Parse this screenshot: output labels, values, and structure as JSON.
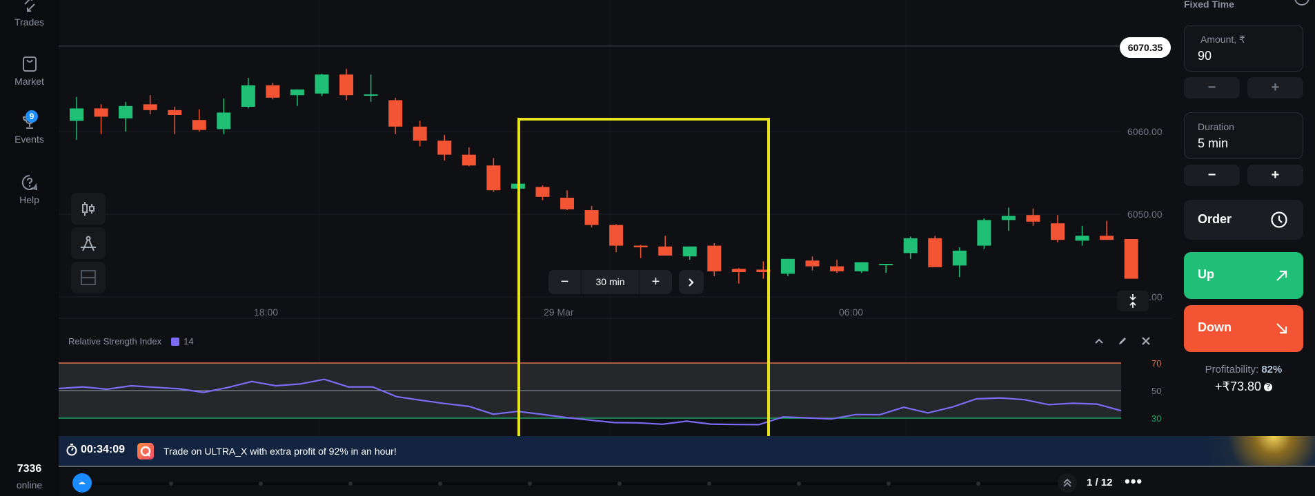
{
  "sidebar": {
    "items": [
      {
        "label": "Trades",
        "icon": "trades-icon"
      },
      {
        "label": "Market",
        "icon": "shopping-bag-icon"
      },
      {
        "label": "Events",
        "icon": "trophy-icon",
        "badge": "9"
      },
      {
        "label": "Help",
        "icon": "help-icon"
      }
    ],
    "online_count": "7336",
    "online_label": "online"
  },
  "chart": {
    "current_price": "6070.35",
    "price_labels": [
      "6060.00",
      "6050.00",
      "6040.00"
    ],
    "time_labels": [
      "18:00",
      "29 Mar",
      "06:00"
    ],
    "timeframe": {
      "minus": "−",
      "value": "30 min",
      "plus": "+",
      "next": "›"
    },
    "colors": {
      "up": "#1fbf75",
      "down": "#f25434",
      "highlight": "#e6e31e",
      "rsi_line": "#7b6cf6"
    },
    "tools": [
      "candlestick-type-icon",
      "drawing-tools-icon",
      "indicators-layout-icon"
    ]
  },
  "chart_data": [
    {
      "type": "candlestick",
      "title": "",
      "y_axis_labels": [
        6060.0,
        6050.0,
        6040.0
      ],
      "ylim": [
        6040,
        6072
      ],
      "current_price": 6070.35,
      "x_tick_labels": [
        "18:00",
        "29 Mar",
        "06:00"
      ],
      "interval": "30 min",
      "candles": [
        {
          "o": 6061.3,
          "h": 6064.2,
          "l": 6059.0,
          "c": 6062.8
        },
        {
          "o": 6062.8,
          "h": 6063.3,
          "l": 6059.7,
          "c": 6061.8
        },
        {
          "o": 6061.6,
          "h": 6063.6,
          "l": 6060.0,
          "c": 6063.1
        },
        {
          "o": 6063.3,
          "h": 6064.4,
          "l": 6062.1,
          "c": 6062.6
        },
        {
          "o": 6062.6,
          "h": 6063.0,
          "l": 6059.7,
          "c": 6062.0
        },
        {
          "o": 6061.4,
          "h": 6062.7,
          "l": 6060.0,
          "c": 6060.2
        },
        {
          "o": 6060.3,
          "h": 6064.0,
          "l": 6059.7,
          "c": 6062.3
        },
        {
          "o": 6063.0,
          "h": 6066.5,
          "l": 6062.8,
          "c": 6065.6
        },
        {
          "o": 6065.6,
          "h": 6065.9,
          "l": 6063.9,
          "c": 6064.1
        },
        {
          "o": 6064.4,
          "h": 6065.1,
          "l": 6063.1,
          "c": 6065.1
        },
        {
          "o": 6064.6,
          "h": 6067.0,
          "l": 6064.3,
          "c": 6066.9
        },
        {
          "o": 6066.9,
          "h": 6067.6,
          "l": 6063.8,
          "c": 6064.4
        },
        {
          "o": 6064.5,
          "h": 6066.9,
          "l": 6063.6,
          "c": 6064.5
        },
        {
          "o": 6063.8,
          "h": 6064.1,
          "l": 6059.7,
          "c": 6060.6
        },
        {
          "o": 6060.6,
          "h": 6061.3,
          "l": 6058.2,
          "c": 6058.9
        },
        {
          "o": 6058.9,
          "h": 6059.6,
          "l": 6056.5,
          "c": 6057.2
        },
        {
          "o": 6057.2,
          "h": 6058.1,
          "l": 6055.8,
          "c": 6055.9
        },
        {
          "o": 6055.9,
          "h": 6056.8,
          "l": 6052.7,
          "c": 6052.9
        },
        {
          "o": 6053.1,
          "h": 6053.6,
          "l": 6051.2,
          "c": 6053.7
        },
        {
          "o": 6053.3,
          "h": 6053.5,
          "l": 6051.7,
          "c": 6052.1
        },
        {
          "o": 6052.0,
          "h": 6052.9,
          "l": 6050.5,
          "c": 6050.6
        },
        {
          "o": 6050.5,
          "h": 6051.0,
          "l": 6048.4,
          "c": 6048.7
        },
        {
          "o": 6048.7,
          "h": 6048.8,
          "l": 6045.4,
          "c": 6046.2
        },
        {
          "o": 6046.2,
          "h": 6046.3,
          "l": 6044.7,
          "c": 6046.0
        },
        {
          "o": 6046.1,
          "h": 6047.4,
          "l": 6045.0,
          "c": 6045.0
        },
        {
          "o": 6044.9,
          "h": 6046.1,
          "l": 6044.5,
          "c": 6046.1
        },
        {
          "o": 6046.2,
          "h": 6046.5,
          "l": 6042.5,
          "c": 6043.1
        },
        {
          "o": 6043.4,
          "h": 6043.5,
          "l": 6041.6,
          "c": 6043.0
        },
        {
          "o": 6043.3,
          "h": 6044.3,
          "l": 6042.2,
          "c": 6043.0
        },
        {
          "o": 6042.8,
          "h": 6044.6,
          "l": 6042.5,
          "c": 6044.6
        },
        {
          "o": 6044.4,
          "h": 6044.9,
          "l": 6043.2,
          "c": 6043.7
        },
        {
          "o": 6043.7,
          "h": 6044.5,
          "l": 6042.9,
          "c": 6043.1
        },
        {
          "o": 6043.1,
          "h": 6044.2,
          "l": 6042.9,
          "c": 6044.2
        },
        {
          "o": 6044.0,
          "h": 6044.0,
          "l": 6042.9,
          "c": 6044.0
        },
        {
          "o": 6045.3,
          "h": 6047.3,
          "l": 6044.6,
          "c": 6047.1
        },
        {
          "o": 6047.1,
          "h": 6047.4,
          "l": 6043.6,
          "c": 6043.6
        },
        {
          "o": 6043.8,
          "h": 6046.0,
          "l": 6042.4,
          "c": 6045.6
        },
        {
          "o": 6046.2,
          "h": 6049.5,
          "l": 6045.8,
          "c": 6049.3
        },
        {
          "o": 6049.3,
          "h": 6050.8,
          "l": 6048.0,
          "c": 6049.8
        },
        {
          "o": 6049.9,
          "h": 6050.7,
          "l": 6048.6,
          "c": 6049.1
        },
        {
          "o": 6048.9,
          "h": 6049.9,
          "l": 6046.6,
          "c": 6046.9
        },
        {
          "o": 6046.8,
          "h": 6048.6,
          "l": 6046.2,
          "c": 6047.4
        },
        {
          "o": 6047.4,
          "h": 6049.2,
          "l": 6046.9,
          "c": 6046.9
        },
        {
          "o": 6047.0,
          "h": 6047.0,
          "l": 6042.2,
          "c": 6042.2
        }
      ],
      "highlight_box": {
        "from_candle": 18,
        "to_candle": 27
      }
    },
    {
      "type": "line",
      "title": "Relative Strength Index",
      "period": "14",
      "y_levels": [
        70,
        50,
        30
      ],
      "ylim": [
        20,
        72
      ],
      "series": [
        {
          "name": "RSI 14",
          "values": [
            51.5,
            52.7,
            51.0,
            53.5,
            52.4,
            51.3,
            48.7,
            52.2,
            56.6,
            53.5,
            54.8,
            58.2,
            52.7,
            52.7,
            45.6,
            43.0,
            40.6,
            38.5,
            32.9,
            34.9,
            32.8,
            30.5,
            28.6,
            26.8,
            26.6,
            25.6,
            27.8,
            25.7,
            25.4,
            25.3,
            30.9,
            30.2,
            29.4,
            32.6,
            32.5,
            37.9,
            33.8,
            38.0,
            44.0,
            44.7,
            43.4,
            39.8,
            40.8,
            40.2,
            35.4
          ]
        }
      ]
    }
  ],
  "rsi": {
    "title": "Relative Strength Index",
    "period": "14",
    "levels": [
      "70",
      "50",
      "30"
    ]
  },
  "banner": {
    "timer": "00:34:09",
    "message": "Trade on ULTRA_X with extra profit of 92% in an hour!"
  },
  "timeline": {
    "page": "1 / 12",
    "more": "•••"
  },
  "panel": {
    "title": "Fixed Time",
    "amount_label": "Amount, ₹",
    "amount_value": "90",
    "duration_label": "Duration",
    "duration_value": "5 min",
    "minus": "−",
    "plus": "+",
    "order_label": "Order",
    "up_label": "Up",
    "down_label": "Down",
    "profitability_label": "Profitability:",
    "profitability_value": "82%",
    "payout": "+₹73.80",
    "help": "?"
  }
}
